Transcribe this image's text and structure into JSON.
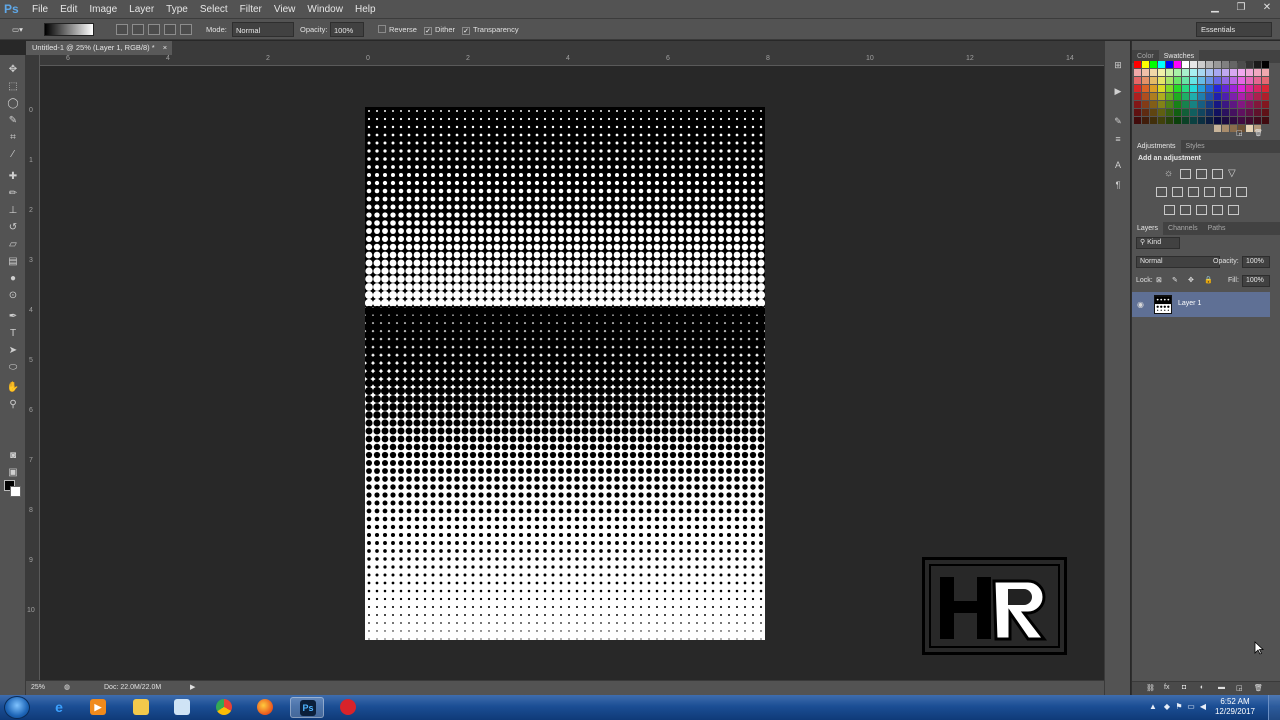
{
  "app": {
    "logo": "Ps"
  },
  "menu": [
    "File",
    "Edit",
    "Image",
    "Layer",
    "Type",
    "Select",
    "Filter",
    "View",
    "Window",
    "Help"
  ],
  "window_controls": [
    "minimize-icon",
    "restore-icon",
    "close-icon"
  ],
  "options": {
    "mode_label": "Mode:",
    "mode_value": "Normal",
    "opacity_label": "Opacity:",
    "opacity_value": "100%",
    "reverse_label": "Reverse",
    "reverse_checked": false,
    "dither_label": "Dither",
    "dither_checked": true,
    "transparency_label": "Transparency",
    "transparency_checked": true,
    "workspace": "Essentials"
  },
  "document": {
    "tab_title": "Untitled-1 @ 25% (Layer 1, RGB/8) *",
    "tab_close": "×"
  },
  "rulers": {
    "top": [
      "6",
      "4",
      "2",
      "0",
      "2",
      "4",
      "6",
      "8",
      "10",
      "12",
      "14"
    ],
    "left": [
      "0",
      "1",
      "2",
      "3",
      "4",
      "5",
      "6",
      "7",
      "8",
      "9",
      "10"
    ]
  },
  "status": {
    "zoom": "25%",
    "doc_size": "Doc: 22.0M/22.0M"
  },
  "panels": {
    "top_tabs": [
      "Color",
      "Swatches"
    ],
    "top_active": "Swatches",
    "mid_tabs": [
      "Adjustments",
      "Styles"
    ],
    "mid_active": "Adjustments",
    "adjust_title": "Add an adjustment",
    "layer_tabs": [
      "Layers",
      "Channels",
      "Paths"
    ],
    "layer_active": "Layers",
    "kind_label": "Kind",
    "blend_mode": "Normal",
    "opacity_label": "Opacity:",
    "opacity_value": "100%",
    "lock_label": "Lock:",
    "fill_label": "Fill:",
    "fill_value": "100%",
    "layer_name": "Layer 1"
  },
  "canvas_logo_text": "HR",
  "taskbar": {
    "apps": [
      "internet-explorer-icon",
      "media-player-icon",
      "file-explorer-icon",
      "notepad-icon",
      "chrome-icon",
      "firefox-icon",
      "photoshop-icon",
      "opera-icon"
    ],
    "active_app": "photoshop-icon",
    "time": "6:52 AM",
    "date": "12/29/2017"
  },
  "colors": {
    "ui_dark": "#282828",
    "ui_panel": "#535353",
    "layer_selected": "#5f7095",
    "taskbar": "#1b4e94"
  }
}
